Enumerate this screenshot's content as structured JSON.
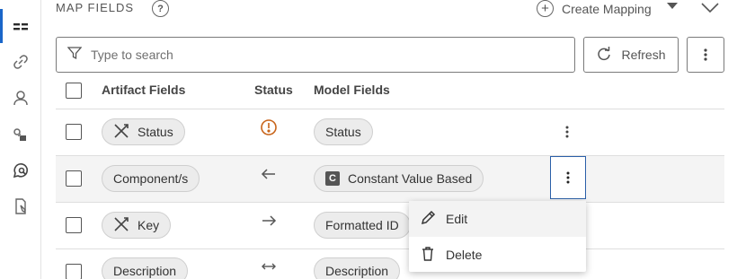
{
  "header": {
    "title": "MAP FIELDS",
    "help": "?",
    "create_label": "Create Mapping"
  },
  "search": {
    "placeholder": "Type to search"
  },
  "toolbar": {
    "refresh_label": "Refresh"
  },
  "table": {
    "columns": [
      "Artifact Fields",
      "Status",
      "Model Fields"
    ],
    "rows": [
      {
        "artifact": "Status",
        "artifact_icon": "unlinked-icon",
        "status_icon": "warning-icon",
        "model": "Status",
        "model_icon": ""
      },
      {
        "artifact": "Component/s",
        "artifact_icon": "",
        "status_icon": "arrow-left-icon",
        "model": "Constant Value Based",
        "model_icon": "C"
      },
      {
        "artifact": "Key",
        "artifact_icon": "unlinked-icon",
        "status_icon": "arrow-right-icon",
        "model": "Formatted ID",
        "model_icon": ""
      },
      {
        "artifact": "Description",
        "artifact_icon": "",
        "status_icon": "arrow-both-icon",
        "model": "Description",
        "model_icon": ""
      }
    ]
  },
  "menu": {
    "items": [
      "Edit",
      "Delete"
    ]
  },
  "colors": {
    "accent": "#1a66c9",
    "warning": "#c8641a",
    "focus": "#2a5fa8"
  }
}
